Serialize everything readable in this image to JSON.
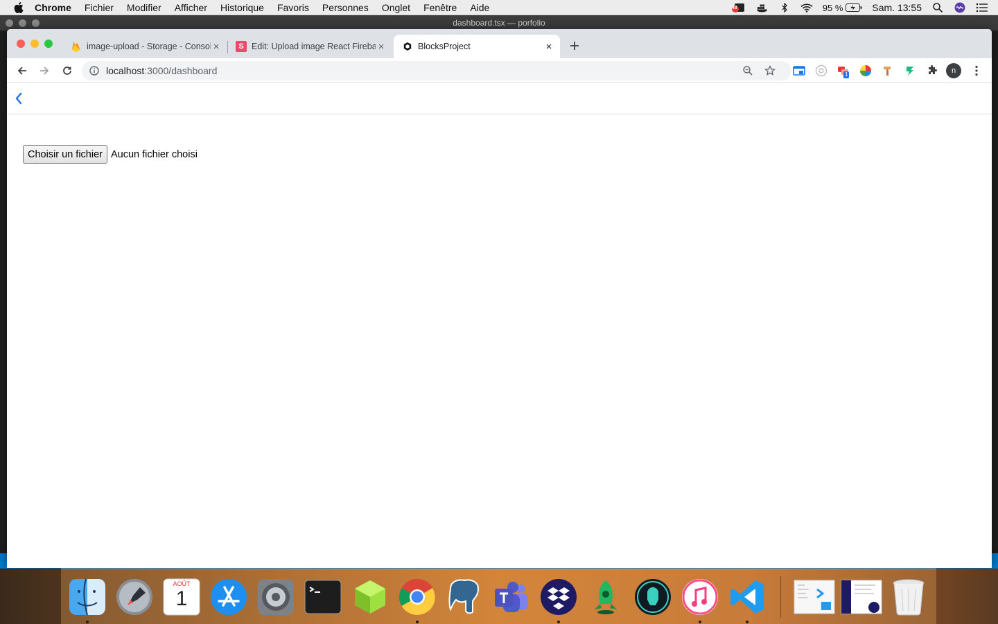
{
  "menubar": {
    "app_name": "Chrome",
    "items": [
      "Fichier",
      "Modifier",
      "Afficher",
      "Historique",
      "Favoris",
      "Personnes",
      "Onglet",
      "Fenêtre",
      "Aide"
    ],
    "notification_badge": "48",
    "battery": "95 %",
    "clock": "Sam. 13:55"
  },
  "background_window": {
    "title": "dashboard.tsx — porfolio"
  },
  "tabs": [
    {
      "title": "image-upload - Storage - Console Firebase",
      "favicon": "firebase-icon",
      "active": false
    },
    {
      "title": "Edit: Upload image React Firebase",
      "favicon": "s-letter-icon",
      "favicon_letter": "S",
      "active": false
    },
    {
      "title": "BlocksProject",
      "favicon": "blocks-icon",
      "active": true
    }
  ],
  "omnibox": {
    "host": "localhost",
    "rest": ":3000/dashboard"
  },
  "profile": {
    "initial": "n"
  },
  "extension_badge": "1",
  "page": {
    "file_input": {
      "button_label": "Choisir un fichier",
      "status": "Aucun fichier choisi"
    }
  },
  "dock": {
    "calendar_month": "AOÛT",
    "calendar_day": "1",
    "apps": [
      "finder",
      "launchpad",
      "calendar",
      "app-store",
      "system-preferences",
      "terminal",
      "cube-app",
      "chrome",
      "postgres",
      "teams",
      "dropbox",
      "rocket-app",
      "gitkraken",
      "itunes",
      "vscode"
    ]
  },
  "colors": {
    "accent": "#1a73e8",
    "close_red": "#ff5f57",
    "minimize_yellow": "#febc2e",
    "zoom_green": "#28c840"
  }
}
